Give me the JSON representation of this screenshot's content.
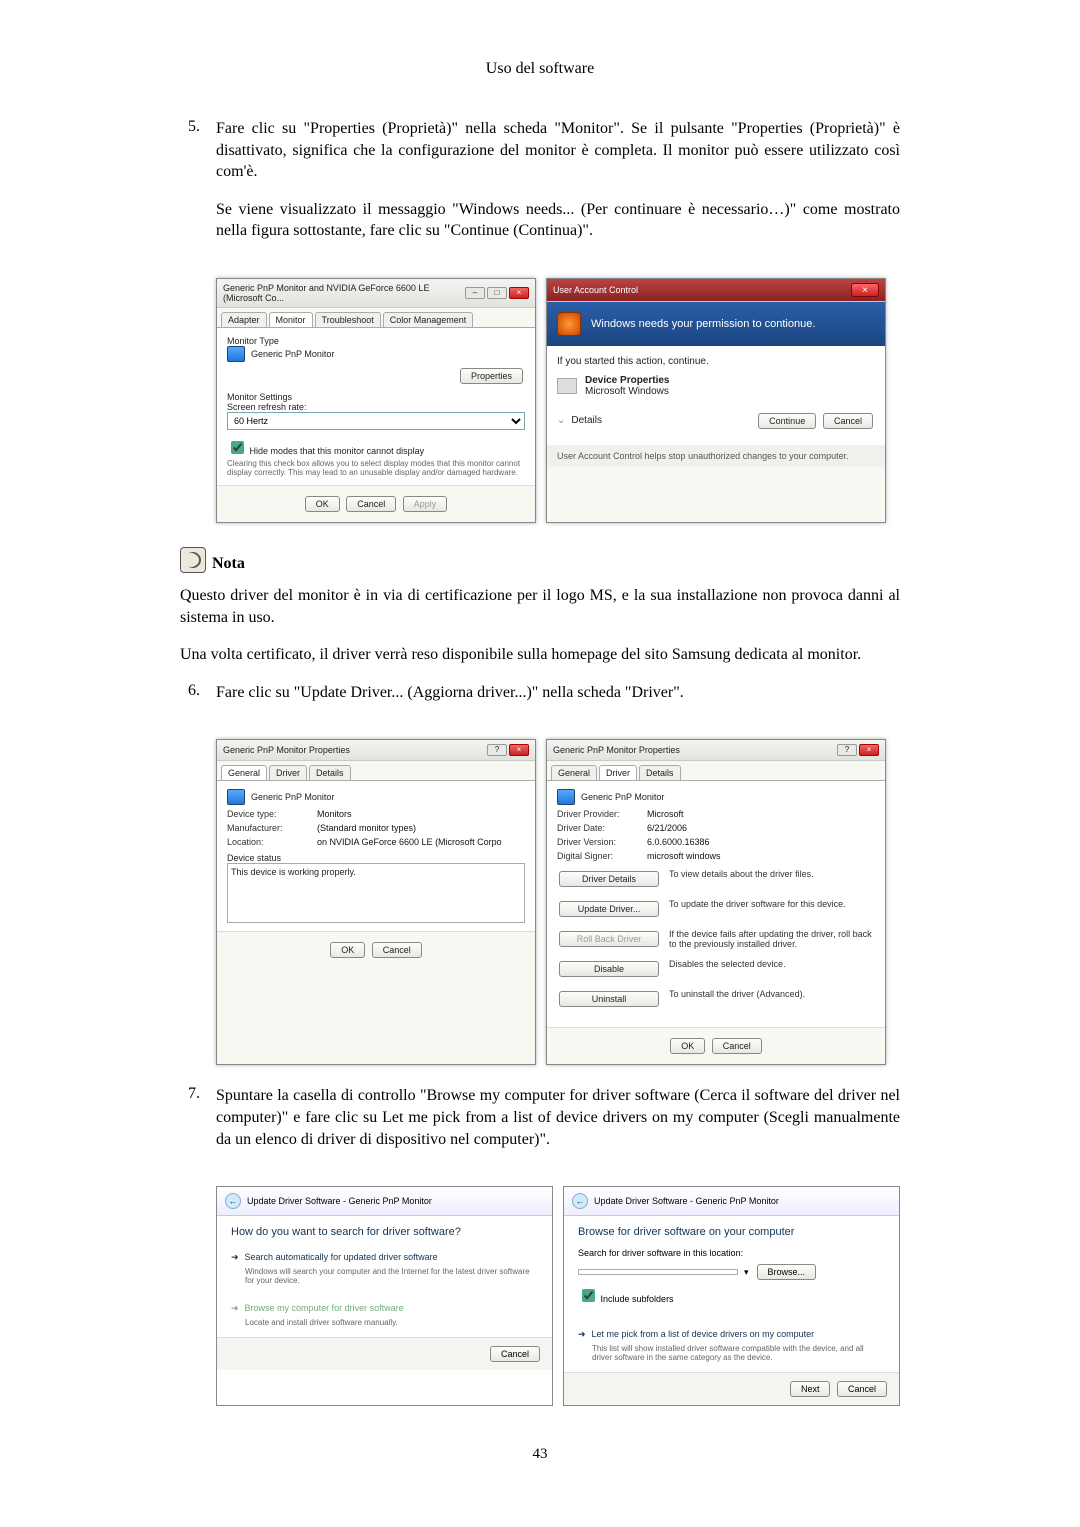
{
  "page_title": "Uso del software",
  "page_number": "43",
  "steps": {
    "s5": {
      "num": "5.",
      "p1": "Fare clic su \"Properties (Proprietà)\" nella scheda \"Monitor\". Se il pulsante \"Properties (Proprietà)\" è disattivato, significa che la configurazione del monitor è completa. Il monitor può essere utilizzato così com'è.",
      "p2": "Se viene visualizzato il messaggio \"Windows needs... (Per continuare è necessario…)\" come mostrato nella figura sottostante, fare clic su \"Continue (Continua)\"."
    },
    "s6": {
      "num": "6.",
      "p1": "Fare clic su \"Update Driver... (Aggiorna driver...)\" nella scheda \"Driver\"."
    },
    "s7": {
      "num": "7.",
      "p1": "Spuntare la casella di controllo \"Browse my computer for driver software (Cerca il software del driver nel computer)\" e fare clic su Let me pick from a list of device drivers on my computer (Scegli manualmente da un elenco di driver di dispositivo nel computer)\"."
    }
  },
  "note": {
    "label": "Nota",
    "p1": "Questo driver del monitor è in via di certificazione per il logo MS, e la sua installazione non provoca danni al sistema in uso.",
    "p2": "Una volta certificato, il driver verrà reso disponibile sulla homepage del sito Samsung dedicata al monitor."
  },
  "dlg_monitor": {
    "title": "Generic PnP Monitor and NVIDIA GeForce 6600 LE (Microsoft Co...",
    "tabs": [
      "Adapter",
      "Monitor",
      "Troubleshoot",
      "Color Management"
    ],
    "section_type": "Monitor Type",
    "monitor_name": "Generic PnP Monitor",
    "properties_btn": "Properties",
    "section_settings": "Monitor Settings",
    "refresh_label": "Screen refresh rate:",
    "refresh_value": "60 Hertz",
    "hide_label": "Hide modes that this monitor cannot display",
    "hide_desc": "Clearing this check box allows you to select display modes that this monitor cannot display correctly. This may lead to an unusable display and/or damaged hardware.",
    "ok": "OK",
    "cancel": "Cancel",
    "apply": "Apply"
  },
  "dlg_uac": {
    "title": "User Account Control",
    "headline": "Windows needs your permission to contionue.",
    "started": "If you started this action, continue.",
    "item_title": "Device Properties",
    "item_pub": "Microsoft Windows",
    "details": "Details",
    "continue": "Continue",
    "cancel": "Cancel",
    "footer": "User Account Control helps stop unauthorized changes to your computer."
  },
  "dlg_props_general": {
    "title": "Generic PnP Monitor Properties",
    "tabs": [
      "General",
      "Driver",
      "Details"
    ],
    "name": "Generic PnP Monitor",
    "device_type_lbl": "Device type:",
    "device_type": "Monitors",
    "manufacturer_lbl": "Manufacturer:",
    "manufacturer": "(Standard monitor types)",
    "location_lbl": "Location:",
    "location": "on NVIDIA GeForce 6600 LE (Microsoft Corpo",
    "status_lbl": "Device status",
    "status": "This device is working properly.",
    "ok": "OK",
    "cancel": "Cancel"
  },
  "dlg_props_driver": {
    "title": "Generic PnP Monitor Properties",
    "tabs": [
      "General",
      "Driver",
      "Details"
    ],
    "name": "Generic PnP Monitor",
    "provider_lbl": "Driver Provider:",
    "provider": "Microsoft",
    "date_lbl": "Driver Date:",
    "date": "6/21/2006",
    "version_lbl": "Driver Version:",
    "version": "6.0.6000.16386",
    "signer_lbl": "Digital Signer:",
    "signer": "microsoft windows",
    "btn_details": "Driver Details",
    "desc_details": "To view details about the driver files.",
    "btn_update": "Update Driver...",
    "desc_update": "To update the driver software for this device.",
    "btn_rollback": "Roll Back Driver",
    "desc_rollback": "If the device fails after updating the driver, roll back to the previously installed driver.",
    "btn_disable": "Disable",
    "desc_disable": "Disables the selected device.",
    "btn_uninstall": "Uninstall",
    "desc_uninstall": "To uninstall the driver (Advanced).",
    "ok": "OK",
    "cancel": "Cancel"
  },
  "wiz_search": {
    "breadcrumb": "Update Driver Software - Generic PnP Monitor",
    "heading": "How do you want to search for driver software?",
    "opt1": "Search automatically for updated driver software",
    "opt1_desc": "Windows will search your computer and the Internet for the latest driver software for your device.",
    "opt2": "Browse my computer for driver software",
    "opt2_desc": "Locate and install driver software manually.",
    "cancel": "Cancel"
  },
  "wiz_browse": {
    "breadcrumb": "Update Driver Software - Generic PnP Monitor",
    "heading": "Browse for driver software on your computer",
    "path_lbl": "Search for driver software in this location:",
    "path": " ",
    "browse": "Browse...",
    "include": "Include subfolders",
    "opt": "Let me pick from a list of device drivers on my computer",
    "opt_desc": "This list will show installed driver software compatible with the device, and all driver software in the same category as the device.",
    "next": "Next",
    "cancel": "Cancel"
  }
}
